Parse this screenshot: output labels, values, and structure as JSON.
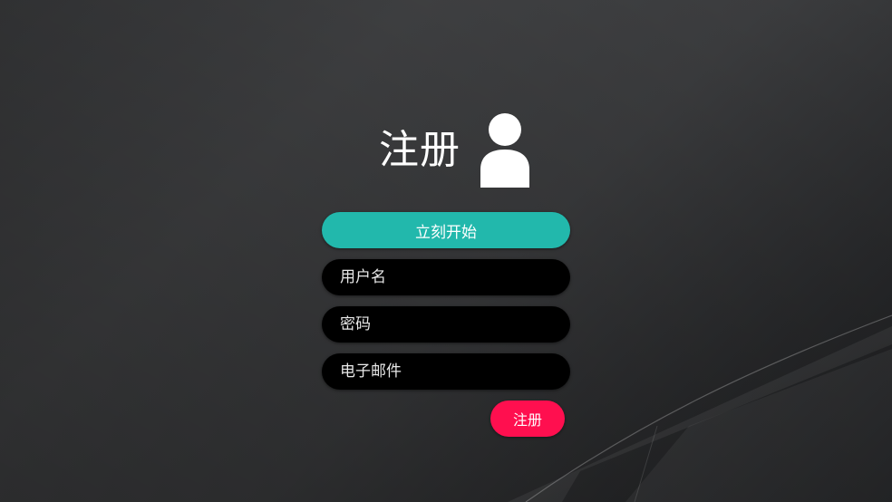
{
  "header": {
    "title": "注册",
    "icon": "user-icon"
  },
  "form": {
    "start_label": "立刻开始",
    "username_placeholder": "用户名",
    "password_placeholder": "密码",
    "email_placeholder": "电子邮件",
    "submit_label": "注册"
  },
  "colors": {
    "start_button": "#22b8ac",
    "submit_button": "#ff0f4f",
    "field_background": "#000000"
  }
}
